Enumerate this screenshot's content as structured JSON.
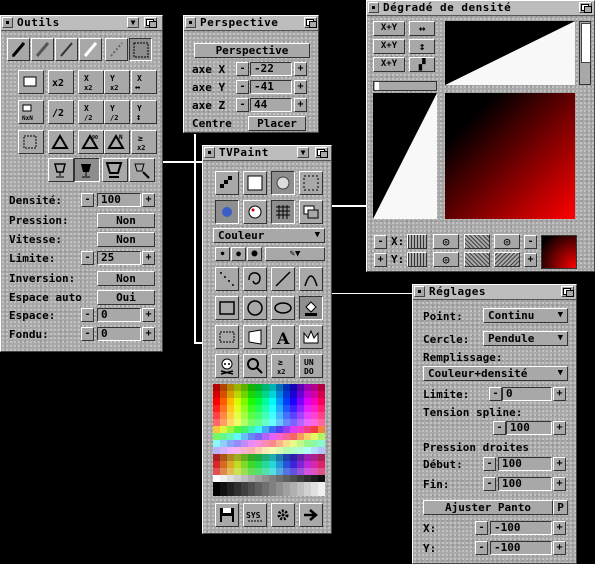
{
  "outils": {
    "title": "Outils",
    "rows": [
      {
        "label": "Densité:",
        "value": "100"
      },
      {
        "label": "Pression:",
        "value": "Non"
      },
      {
        "label": "Vitesse:",
        "value": "Non"
      },
      {
        "label": "Limite:",
        "value": "25"
      },
      {
        "label": "Inversion:",
        "value": "Non"
      },
      {
        "label": "Espace auto",
        "value": "Oui"
      },
      {
        "label": "Espace:",
        "value": "0"
      },
      {
        "label": "Fondu:",
        "value": "0"
      }
    ],
    "tool_icons": [
      "pencil-icon",
      "airbrush-icon",
      "pen-icon",
      "marker-icon",
      "brush-dotted-icon",
      "select-tool-icon",
      "copy-frame-icon",
      "x2-scale-icon",
      "x-half-icon",
      "y-half-icon",
      "flip-horizontal-icon",
      "n-by-n-grid-icon",
      "half-scale-icon",
      "x-scale-icon",
      "y-scale-icon",
      "rotate-icon",
      "selection-box-icon",
      "rotate-free-icon",
      "rotate-90-icon",
      "rotate-n-icon",
      "zoom-x2-icon",
      "cup-icon",
      "cup-filled-icon",
      "cup-large-icon",
      "cup-pointer-icon"
    ],
    "btn_minus": "-",
    "btn_plus": "+"
  },
  "perspective": {
    "title": "Perspective",
    "header_btn": "Perspective",
    "axes": [
      {
        "label": "axe X",
        "value": "-22"
      },
      {
        "label": "axe Y",
        "value": "-41"
      },
      {
        "label": "axe Z",
        "value": "44"
      }
    ],
    "centre_label": "Centre",
    "placer_btn": "Placer"
  },
  "degrade": {
    "title": "Dégradé de densité",
    "swap_buttons": [
      "X+Y",
      "X+Y",
      "X+Y"
    ],
    "x_label": "X:",
    "y_label": "Y:",
    "gradient_colors": {
      "start": "#ff0000",
      "end": "#000000"
    }
  },
  "tvpaint": {
    "title": "TVPaint",
    "mode_select": "Couleur",
    "tool_icons": [
      "dither-icon",
      "gradient-fill-icon",
      "spray-icon",
      "dotted-box-icon",
      "dot-icon",
      "palette-icon",
      "grid-icon",
      "stack-icon",
      "freehand-dots-icon",
      "spiral-icon",
      "line-icon",
      "curve-icon",
      "rectangle-icon",
      "circle-icon",
      "ellipse-icon",
      "fill-bucket-icon",
      "brush-select-icon",
      "perspective-box-icon",
      "text-icon",
      "crown-icon",
      "skull-icon",
      "magnifier-icon",
      "zoom-x2-icon",
      "undo-icon",
      "disk-icon",
      "sys-icon",
      "gear-icon",
      "arrow-right-icon"
    ],
    "undo_label": "UN DO",
    "sys_label": "SYS"
  },
  "reglages": {
    "title": "Réglages",
    "point_label": "Point:",
    "point_value": "Continu",
    "cercle_label": "Cercle:",
    "cercle_value": "Pendule",
    "remplissage_label": "Remplissage:",
    "remplissage_value": "Couleur+densité",
    "limite_label": "Limite:",
    "limite_value": "0",
    "tension_label": "Tension spline:",
    "tension_value": "100",
    "pression_label": "Pression droites",
    "debut_label": "Début:",
    "debut_value": "100",
    "fin_label": "Fin:",
    "fin_value": "100",
    "panto_btn": "Ajuster Panto",
    "panto_p": "P",
    "x_label": "X:",
    "x_value": "-100",
    "y_label": "Y:",
    "y_value": "-100"
  }
}
